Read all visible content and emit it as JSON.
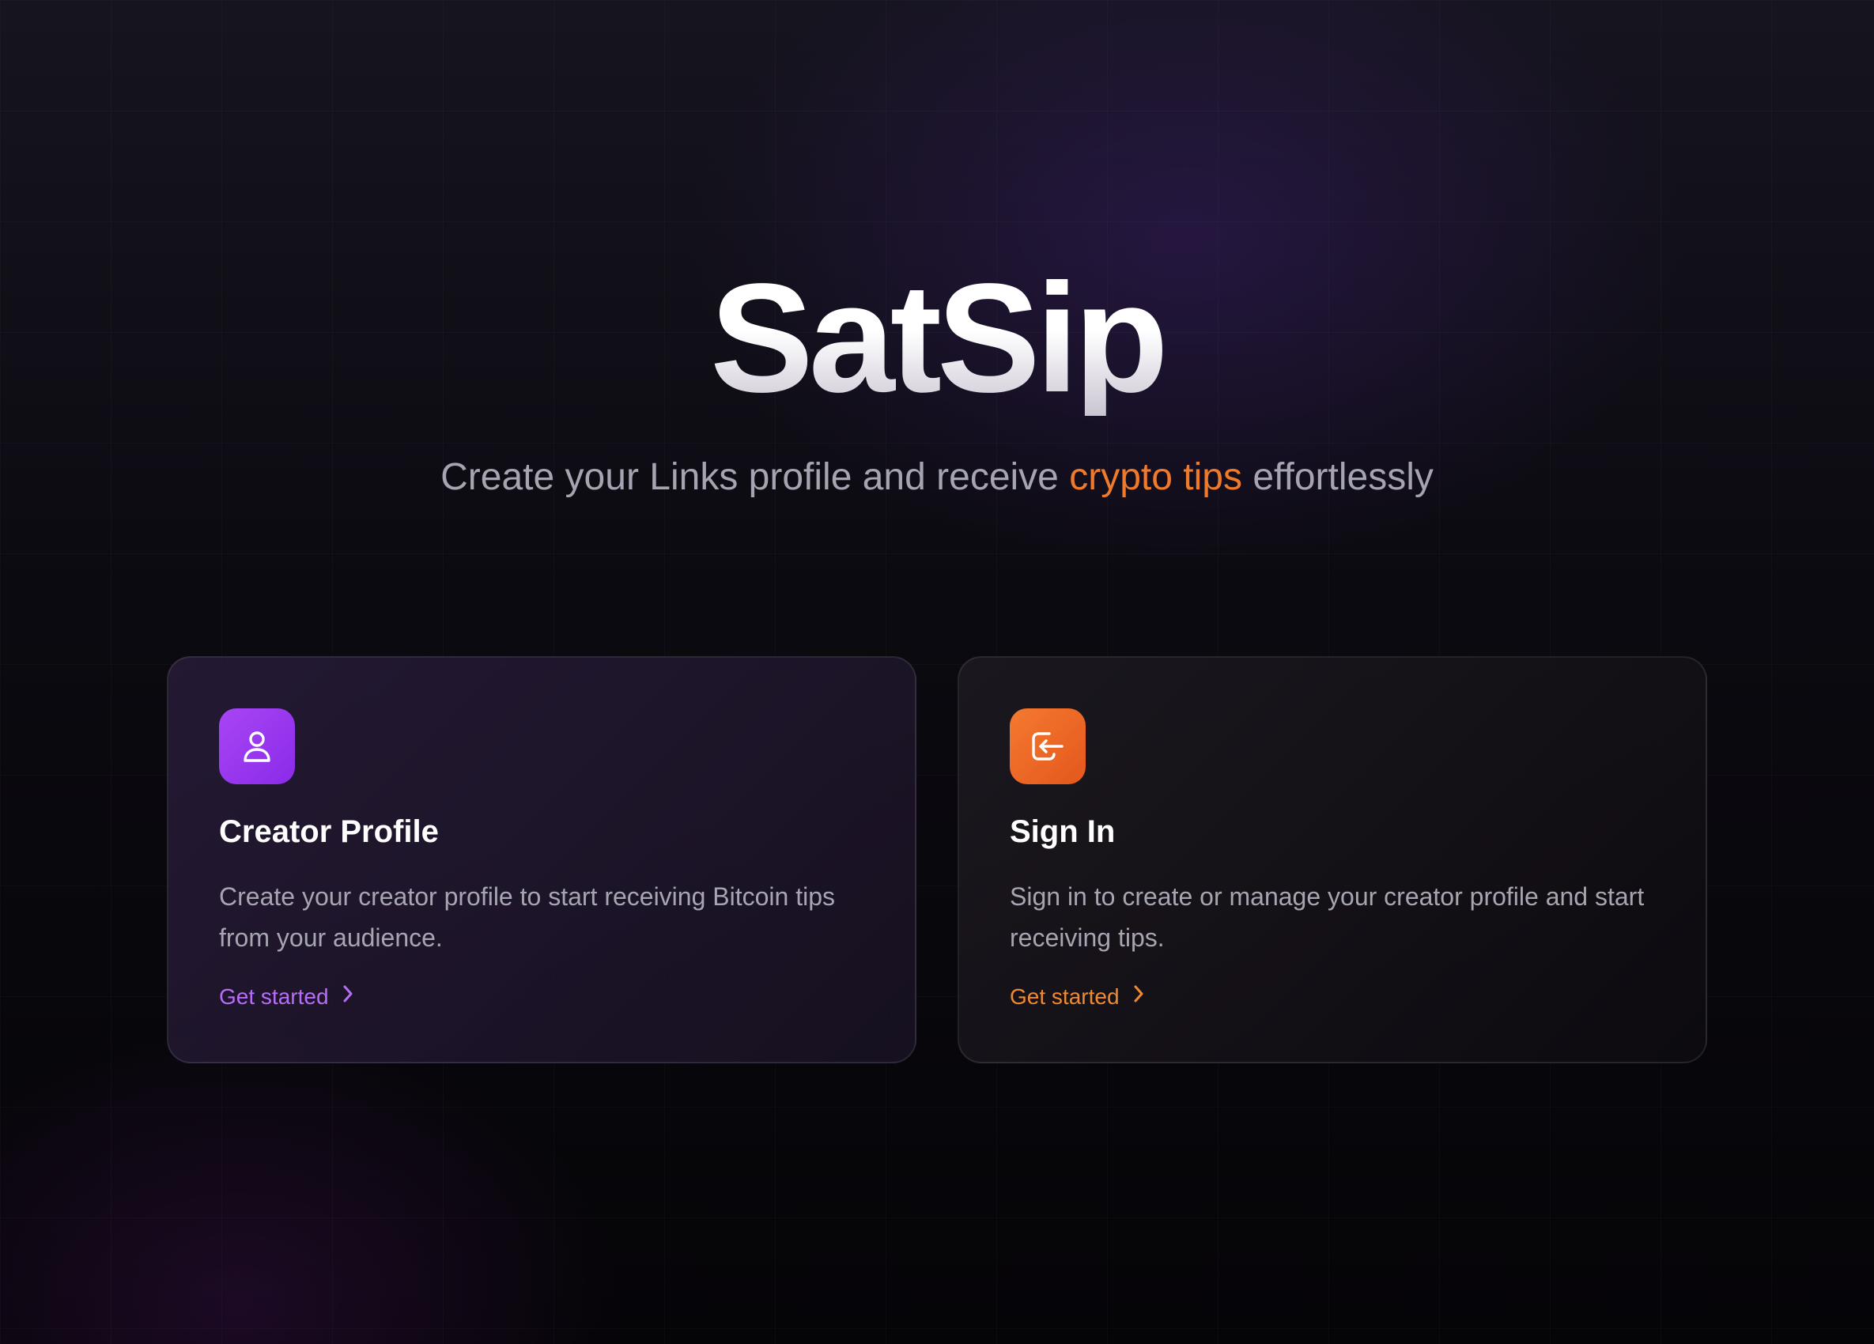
{
  "app": {
    "title": "SatSip",
    "subtitle_prefix": "Create your Links profile and receive",
    "subtitle_accent": "crypto tips",
    "subtitle_suffix": "effortlessly",
    "accent_color": "#f07a2c"
  },
  "cards": [
    {
      "icon": "user-icon",
      "icon_color": "#9b3af0",
      "title": "Creator Profile",
      "description": "Create your creator profile to start receiving Bitcoin tips from your audience.",
      "cta_label": "Get started",
      "cta_color": "#b76ef7"
    },
    {
      "icon": "sign-in-icon",
      "icon_color": "#ee6a25",
      "title": "Sign In",
      "description": "Sign in to create or manage your creator profile and start receiving tips.",
      "cta_label": "Get started",
      "cta_color": "#f08a32"
    }
  ]
}
